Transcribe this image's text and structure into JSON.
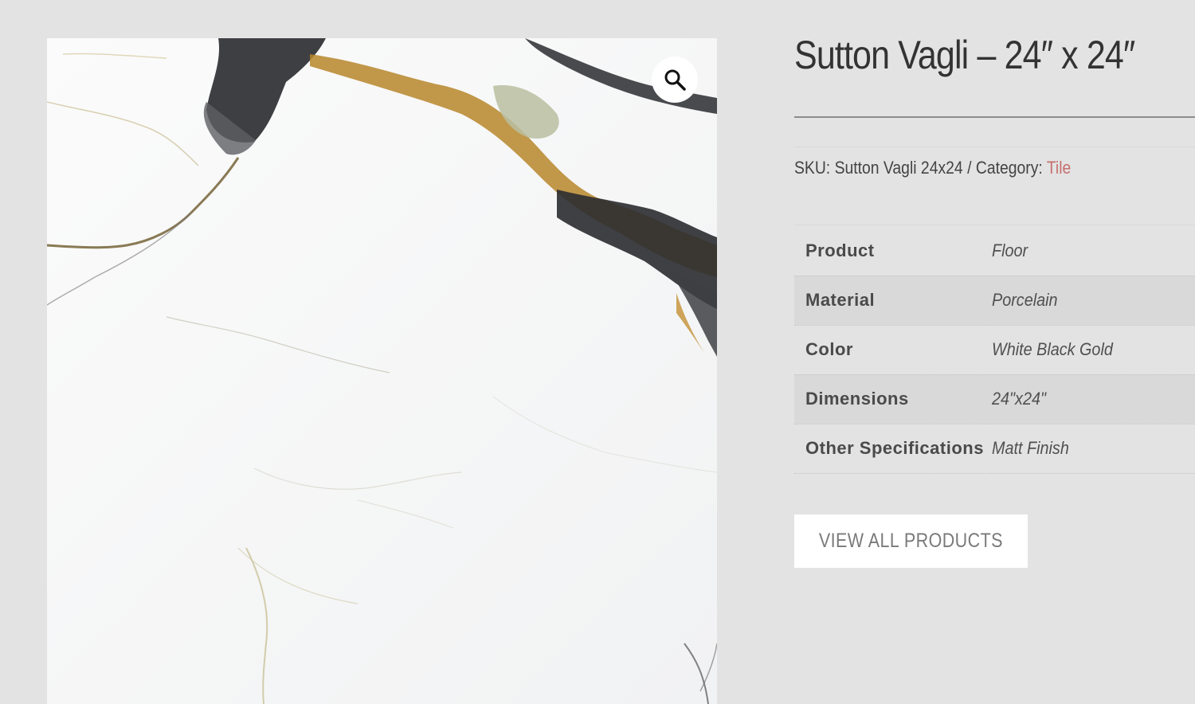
{
  "product": {
    "title": "Sutton Vagli – 24″ x 24″",
    "image_alt": "Sutton Vagli marble tile",
    "zoom_icon": "magnifier-zoom-icon"
  },
  "meta": {
    "sku_label": "SKU:",
    "sku_value": "Sutton Vagli 24x24",
    "separator": "/",
    "category_label": "Category:",
    "category_value": "Tile",
    "category_color": "#c4706e"
  },
  "attributes": [
    {
      "label": "Product",
      "value": "Floor"
    },
    {
      "label": "Material",
      "value": "Porcelain"
    },
    {
      "label": "Color",
      "value": "White Black Gold"
    },
    {
      "label": "Dimensions",
      "value": "24\"x24\""
    },
    {
      "label": "Other Specifications",
      "value": "Matt Finish"
    }
  ],
  "actions": {
    "view_all_label": "VIEW ALL PRODUCTS"
  },
  "colors": {
    "background": "#e3e3e3",
    "stripe_row": "#d9d9d9",
    "button_bg": "#ffffff"
  }
}
